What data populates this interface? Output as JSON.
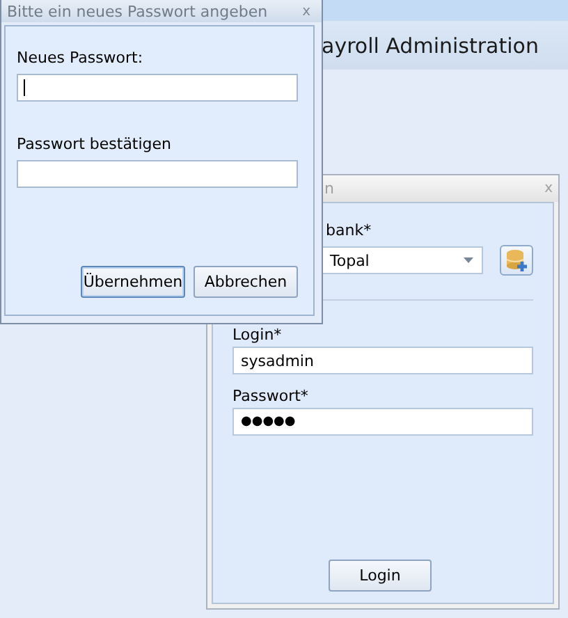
{
  "app": {
    "title": "ayroll Administration"
  },
  "login_window": {
    "title": "n",
    "close": "x",
    "database_label": "bank*",
    "database_value": "Topal",
    "login_label": "Login*",
    "login_value": "sysadmin",
    "password_label": "Passwort*",
    "password_value": "●●●●●",
    "button": "Login"
  },
  "dialog": {
    "title": "Bitte ein neues Passwort angeben",
    "close": "x",
    "new_password_label": "Neues Passwort:",
    "confirm_label": "Passwort bestätigen",
    "buttons": [
      {
        "label": "Übernehmen",
        "selected": true
      },
      {
        "label": "Abbrechen",
        "selected": false
      }
    ]
  }
}
